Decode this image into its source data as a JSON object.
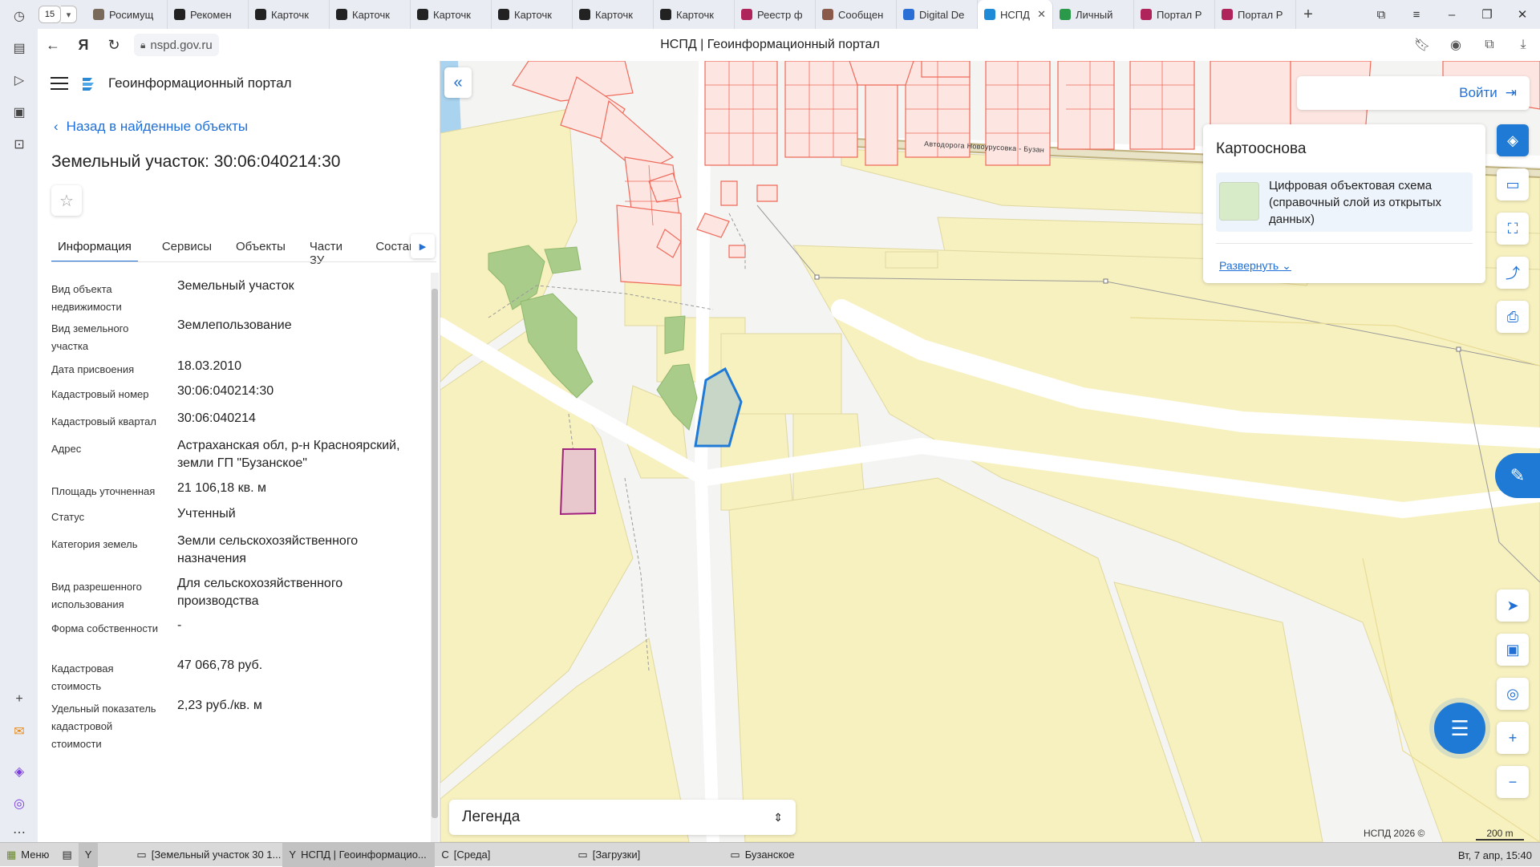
{
  "browser": {
    "tab_count": "15",
    "tabs": [
      {
        "label": "Росимущ",
        "icon": "rosim-icon",
        "color": "#7a6a5a"
      },
      {
        "label": "Рекомен",
        "icon": "a-letter-icon",
        "color": "#222222"
      },
      {
        "label": "Карточк",
        "icon": "a-letter-icon",
        "color": "#222222"
      },
      {
        "label": "Карточк",
        "icon": "a-letter-icon",
        "color": "#222222"
      },
      {
        "label": "Карточк",
        "icon": "a-letter-icon",
        "color": "#222222"
      },
      {
        "label": "Карточк",
        "icon": "a-letter-icon",
        "color": "#222222"
      },
      {
        "label": "Карточк",
        "icon": "a-letter-icon",
        "color": "#222222"
      },
      {
        "label": "Карточк",
        "icon": "a-letter-icon",
        "color": "#222222"
      },
      {
        "label": "Реестр ф",
        "icon": "registry-icon",
        "color": "#b0245c"
      },
      {
        "label": "Сообщен",
        "icon": "messages-icon",
        "color": "#8a5a4a"
      },
      {
        "label": "Digital De",
        "icon": "digital-icon",
        "color": "#2a6fd6"
      },
      {
        "label": "НСПД",
        "icon": "nspd-icon",
        "color": "#1f8ad6",
        "active": true
      },
      {
        "label": "Личный",
        "icon": "gosuslugi-icon",
        "color": "#2a9a4a"
      },
      {
        "label": "Портал Р",
        "icon": "portal-icon",
        "color": "#b0245c"
      },
      {
        "label": "Портал Р",
        "icon": "portal-icon",
        "color": "#b0245c"
      }
    ],
    "url": "nspd.gov.ru",
    "page_title": "НСПД | Геоинформационный портал"
  },
  "panel": {
    "app_title": "Геоинформационный портал",
    "back_label": "Назад в найденные объекты",
    "object_title": "Земельный участок: 30:06:040214:30",
    "tabs": [
      "Информация",
      "Сервисы",
      "Объекты",
      "Части ЗУ",
      "Состав"
    ],
    "attributes": [
      {
        "key": "Вид объекта недвижимости",
        "value": "Земельный участок"
      },
      {
        "key": "Вид земельного участка",
        "value": "Землепользование"
      },
      {
        "key": "Дата присвоения",
        "value": "18.03.2010"
      },
      {
        "key": "Кадастровый номер",
        "value": "30:06:040214:30"
      },
      {
        "key": "Кадастровый квартал",
        "value": "30:06:040214"
      },
      {
        "key": "Адрес",
        "value": "Астраханская обл, р-н Красноярский, земли ГП \"Бузанское\""
      },
      {
        "key": "Площадь уточненная",
        "value": "21 106,18 кв. м"
      },
      {
        "key": "Статус",
        "value": "Учтенный"
      },
      {
        "key": "Категория земель",
        "value": "Земли сельскохозяйственного назначения"
      },
      {
        "key": "Вид разрешенного использования",
        "value": "Для сельскохозяйственного производства"
      },
      {
        "key": "Форма собственности",
        "value": "-"
      },
      {
        "key": "Кадастровая стоимость",
        "value": "47 066,78 руб."
      },
      {
        "key": "Удельный показатель кадастровой стоимости",
        "value": "2,23 руб./кв. м"
      }
    ]
  },
  "map": {
    "login_label": "Войти",
    "basemap_title": "Картооснова",
    "basemap_item": "Цифровая объектовая схема (справочный слой из открытых данных)",
    "expand_label": "Развернуть",
    "legend_label": "Легенда",
    "road_label": "Автодорога Новоурусовка - Бузан",
    "copyright": "НСПД 2026 ©",
    "scale": "200 m",
    "colors": {
      "accent": "#1f7ad6",
      "parcel_fill": "#f7f0bf",
      "building": "#ef6a5a",
      "selected": "#1f7ad6"
    }
  },
  "taskbar": {
    "menu_label": "Меню",
    "items": [
      "[Земельный участок 30 1...",
      "НСПД | Геоинформацио...",
      "[Среда]",
      "[Загрузки]",
      "Бузанское"
    ],
    "clock": "Вт, 7 апр, 15:40"
  }
}
